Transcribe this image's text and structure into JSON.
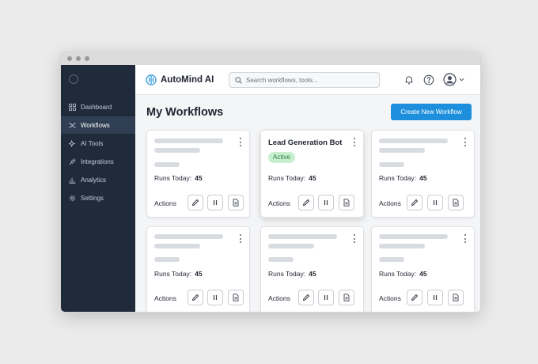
{
  "app": {
    "name": "AutoMind AI"
  },
  "search": {
    "placeholder": "Search workflows, tools..."
  },
  "sidebar": {
    "items": [
      {
        "label": "Dashboard",
        "icon": "dashboard-icon",
        "active": false
      },
      {
        "label": "Workflows",
        "icon": "workflow-icon",
        "active": true
      },
      {
        "label": "AI Tools",
        "icon": "sparkle-icon",
        "active": false
      },
      {
        "label": "Integrations",
        "icon": "plug-icon",
        "active": false
      },
      {
        "label": "Analytics",
        "icon": "bar-chart-icon",
        "active": false
      },
      {
        "label": "Settings",
        "icon": "gear-icon",
        "active": false
      }
    ]
  },
  "header_icons": [
    "bell-icon",
    "help-icon",
    "user-avatar-icon",
    "chevron-down-icon"
  ],
  "main": {
    "title": "My Workflows",
    "create_label": "Create New Workflow"
  },
  "cards": [
    {
      "title": "",
      "status": "",
      "runs_label": "Runs Today:",
      "runs": "45",
      "actions_label": "Actions"
    },
    {
      "title": "Lead Generation Bot",
      "status": "Active",
      "runs_label": "Runs Today:",
      "runs": "45",
      "actions_label": "Actions"
    },
    {
      "title": "",
      "status": "",
      "runs_label": "Runs Today:",
      "runs": "45",
      "actions_label": "Actions"
    },
    {
      "title": "",
      "status": "",
      "runs_label": "Runs Today:",
      "runs": "45",
      "actions_label": "Actions"
    },
    {
      "title": "",
      "status": "",
      "runs_label": "Runs Today:",
      "runs": "45",
      "actions_label": "Actions"
    },
    {
      "title": "",
      "status": "",
      "runs_label": "Runs Today:",
      "runs": "45",
      "actions_label": "Actions"
    }
  ],
  "card_action_icons": [
    "edit-icon",
    "pause-icon",
    "document-icon"
  ],
  "colors": {
    "sidebar_bg": "#1f2b3a",
    "accent": "#1e8fdc",
    "active_badge_bg": "#c7efcf",
    "active_badge_text": "#2f7d3e"
  }
}
